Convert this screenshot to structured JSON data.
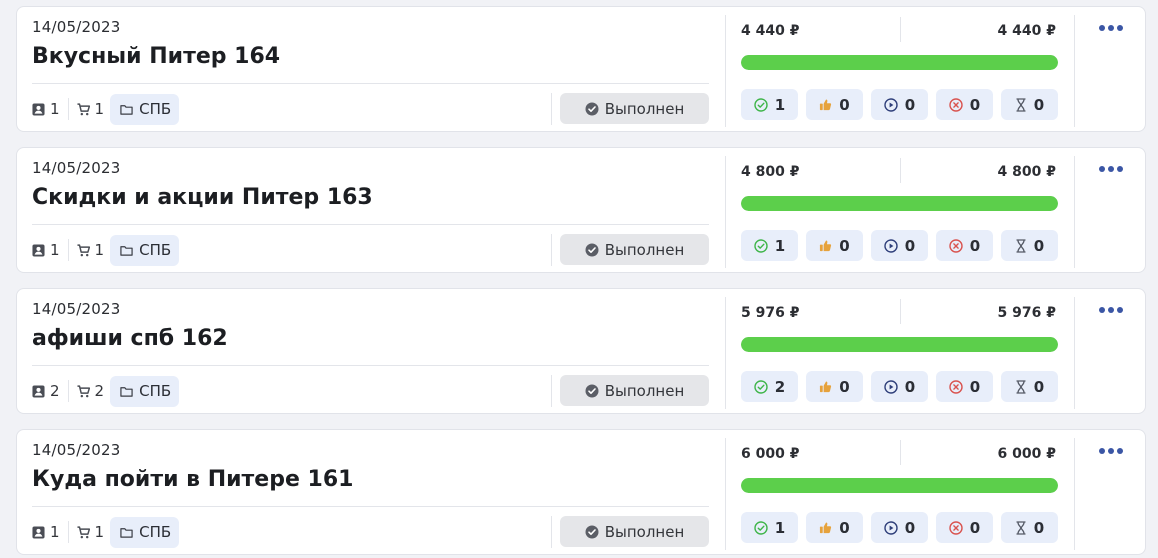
{
  "colors": {
    "progress": "#5ccf4b",
    "tag_bg": "#e8eefa",
    "status_bg": "#e5e6e9",
    "menu_dots": "#3b56a5",
    "check_green": "#3fb54a",
    "like_orange": "#e6a23c",
    "play_navy": "#2f3f7a",
    "cancel_red": "#d9534f",
    "hourglass_gray": "#555a66"
  },
  "orders": [
    {
      "date": "14/05/2023",
      "title": "Вкусный Питер 164",
      "users_count": "1",
      "cart_count": "1",
      "folder": "СПБ",
      "status": "Выполнен",
      "price_paid": "4 440 ₽",
      "price_total": "4 440 ₽",
      "progress": 1.0,
      "counters": {
        "done": "1",
        "liked": "0",
        "in_progress": "0",
        "cancelled": "0",
        "pending": "0"
      }
    },
    {
      "date": "14/05/2023",
      "title": "Скидки и акции Питер 163",
      "users_count": "1",
      "cart_count": "1",
      "folder": "СПБ",
      "status": "Выполнен",
      "price_paid": "4 800 ₽",
      "price_total": "4 800 ₽",
      "progress": 1.0,
      "counters": {
        "done": "1",
        "liked": "0",
        "in_progress": "0",
        "cancelled": "0",
        "pending": "0"
      }
    },
    {
      "date": "14/05/2023",
      "title": "афиши спб 162",
      "users_count": "2",
      "cart_count": "2",
      "folder": "СПБ",
      "status": "Выполнен",
      "price_paid": "5 976 ₽",
      "price_total": "5 976 ₽",
      "progress": 1.0,
      "counters": {
        "done": "2",
        "liked": "0",
        "in_progress": "0",
        "cancelled": "0",
        "pending": "0"
      }
    },
    {
      "date": "14/05/2023",
      "title": "Куда пойти в Питере 161",
      "users_count": "1",
      "cart_count": "1",
      "folder": "СПБ",
      "status": "Выполнен",
      "price_paid": "6 000 ₽",
      "price_total": "6 000 ₽",
      "progress": 1.0,
      "counters": {
        "done": "1",
        "liked": "0",
        "in_progress": "0",
        "cancelled": "0",
        "pending": "0"
      }
    }
  ]
}
